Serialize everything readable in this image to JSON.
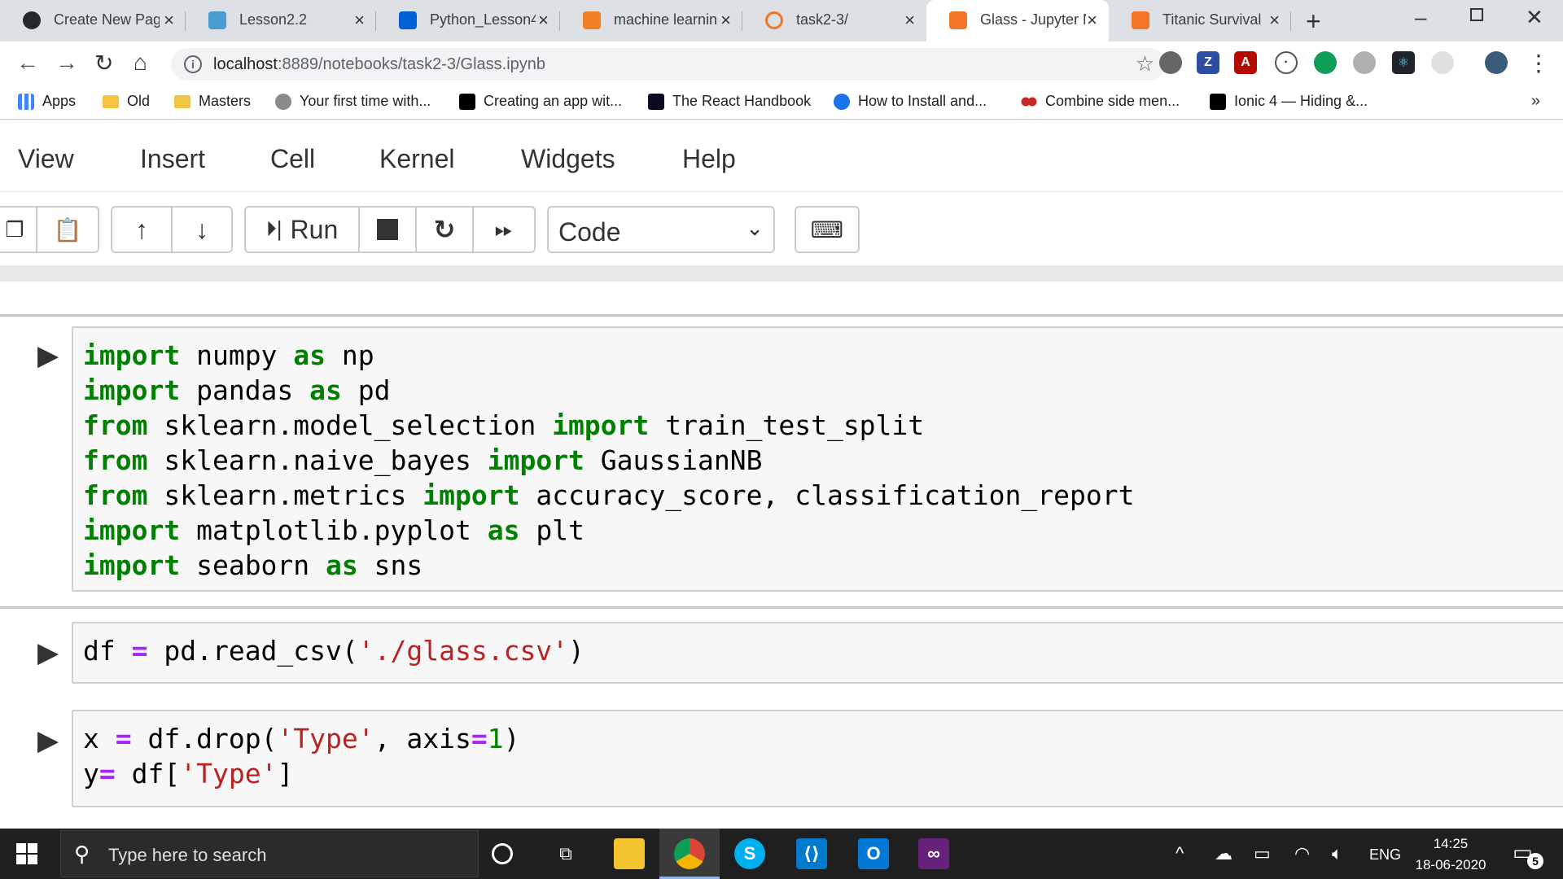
{
  "browser": {
    "tabs": [
      {
        "title": "Create New Pag",
        "favicon": "github-icon",
        "color": "#24292e"
      },
      {
        "title": "Lesson2.2",
        "favicon": "unc-icon",
        "color": "#4b9cd3"
      },
      {
        "title": "Python_Lesson4",
        "favicon": "box-icon",
        "color": "#0061d5"
      },
      {
        "title": "machine learnin",
        "favicon": "stackoverflow-icon",
        "color": "#f48024"
      },
      {
        "title": "task2-3/",
        "favicon": "jupyter-icon",
        "color": "#f37626"
      },
      {
        "title": "Glass - Jupyter N",
        "favicon": "jupyter-notebook-icon",
        "color": "#f37626",
        "active": true
      },
      {
        "title": "Titanic Survival",
        "favicon": "jupyter-notebook-icon",
        "color": "#f37626"
      }
    ],
    "address": {
      "host": "localhost",
      "path": ":8889/notebooks/task2-3/Glass.ipynb"
    },
    "bookmarks": [
      {
        "label": "Apps",
        "icon": "apps-grid-icon"
      },
      {
        "label": "Old",
        "icon": "folder-icon"
      },
      {
        "label": "Masters",
        "icon": "folder-icon"
      },
      {
        "label": "Your first time with...",
        "icon": "person-icon"
      },
      {
        "label": "Creating an app wit...",
        "icon": "dev-icon"
      },
      {
        "label": "The React Handbook",
        "icon": "freecodecamp-icon"
      },
      {
        "label": "How to Install and...",
        "icon": "react-icon"
      },
      {
        "label": "Combine side men...",
        "icon": "red-dots-icon"
      },
      {
        "label": "Ionic 4 — Hiding &...",
        "icon": "medium-icon"
      }
    ],
    "bookmarks_more": "»"
  },
  "jupyter": {
    "menu": [
      "View",
      "Insert",
      "Cell",
      "Kernel",
      "Widgets",
      "Help"
    ],
    "toolbar": {
      "run_label": "Run",
      "cell_type": "Code"
    },
    "cells": [
      {
        "lines": [
          [
            [
              "kw",
              "import"
            ],
            [
              "t",
              " numpy "
            ],
            [
              "kw",
              "as"
            ],
            [
              "t",
              " np"
            ]
          ],
          [
            [
              "kw",
              "import"
            ],
            [
              "t",
              " pandas "
            ],
            [
              "kw",
              "as"
            ],
            [
              "t",
              " pd"
            ]
          ],
          [
            [
              "kw",
              "from"
            ],
            [
              "t",
              " sklearn.model_selection "
            ],
            [
              "kw",
              "import"
            ],
            [
              "t",
              " train_test_split"
            ]
          ],
          [
            [
              "kw",
              "from"
            ],
            [
              "t",
              " sklearn.naive_bayes "
            ],
            [
              "kw",
              "import"
            ],
            [
              "t",
              " GaussianNB"
            ]
          ],
          [
            [
              "kw",
              "from"
            ],
            [
              "t",
              " sklearn.metrics "
            ],
            [
              "kw",
              "import"
            ],
            [
              "t",
              " accuracy_score, classification_report"
            ]
          ],
          [
            [
              "kw",
              "import"
            ],
            [
              "t",
              " matplotlib.pyplot "
            ],
            [
              "kw",
              "as"
            ],
            [
              "t",
              " plt"
            ]
          ],
          [
            [
              "kw",
              "import"
            ],
            [
              "t",
              " seaborn "
            ],
            [
              "kw",
              "as"
            ],
            [
              "t",
              " sns"
            ]
          ]
        ]
      },
      {
        "lines": [
          [
            [
              "t",
              "df "
            ],
            [
              "op",
              "="
            ],
            [
              "t",
              " pd.read_csv("
            ],
            [
              "str",
              "'./glass.csv'"
            ],
            [
              "t",
              ")"
            ]
          ]
        ]
      },
      {
        "lines": [
          [
            [
              "t",
              "x "
            ],
            [
              "op",
              "="
            ],
            [
              "t",
              " df.drop("
            ],
            [
              "str",
              "'Type'"
            ],
            [
              "t",
              ", axis"
            ],
            [
              "op",
              "="
            ],
            [
              "num",
              "1"
            ],
            [
              "t",
              ")"
            ]
          ],
          [
            [
              "t",
              "y"
            ],
            [
              "op",
              "="
            ],
            [
              "t",
              " df["
            ],
            [
              "str",
              "'Type'"
            ],
            [
              "t",
              "]"
            ]
          ]
        ]
      }
    ]
  },
  "taskbar": {
    "search_placeholder": "Type here to search",
    "language": "ENG",
    "time": "14:25",
    "date": "18-06-2020",
    "notification_count": "5"
  }
}
